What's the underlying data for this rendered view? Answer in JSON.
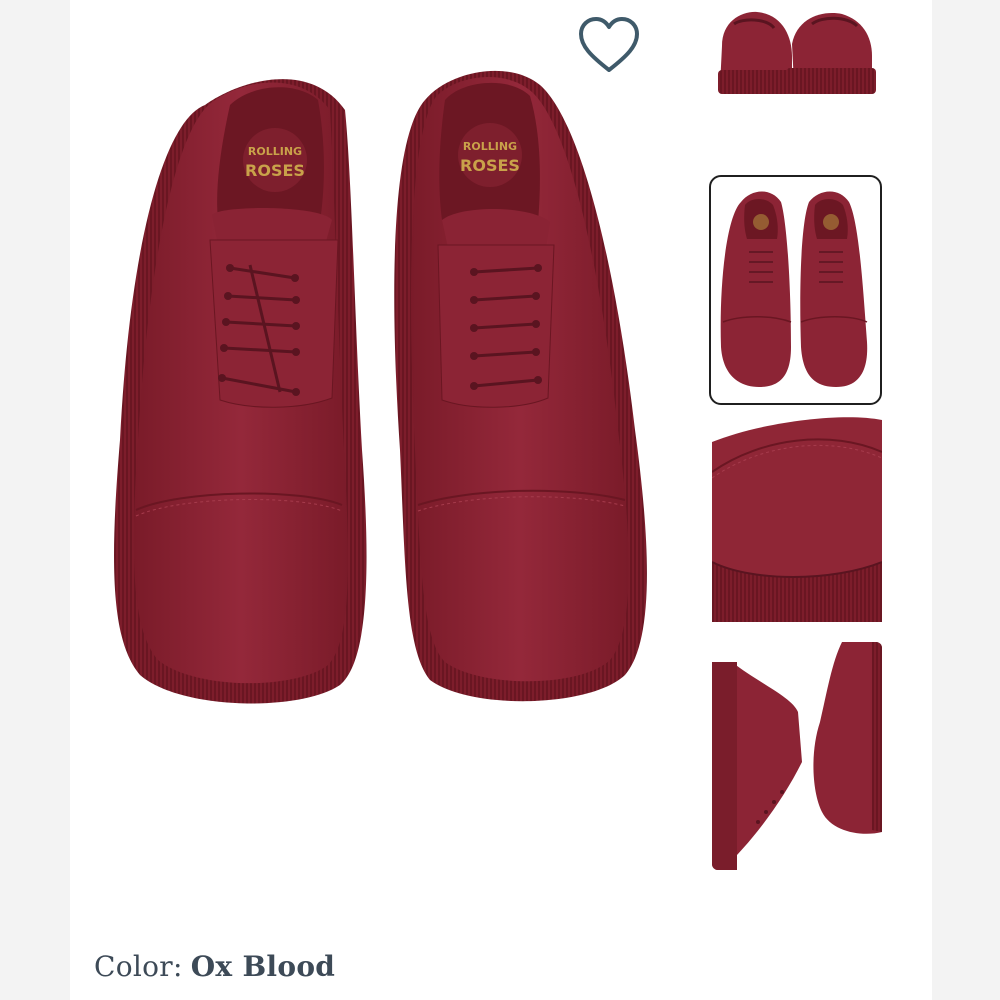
{
  "product": {
    "color_label": "Color:",
    "color_value": "Ox Blood",
    "insole_logo_text": "Rolling Roses"
  },
  "icons": {
    "wishlist": "heart-outline-icon"
  },
  "colors": {
    "shoe": "#8e2232",
    "shoe_dark": "#6f1825",
    "sole": "#7d1d2b",
    "text": "#3d4a57",
    "border": "#1f1f1f"
  },
  "thumbnails": [
    {
      "view": "back"
    },
    {
      "view": "top",
      "selected": true
    },
    {
      "view": "toe-closeup"
    },
    {
      "view": "side"
    }
  ]
}
